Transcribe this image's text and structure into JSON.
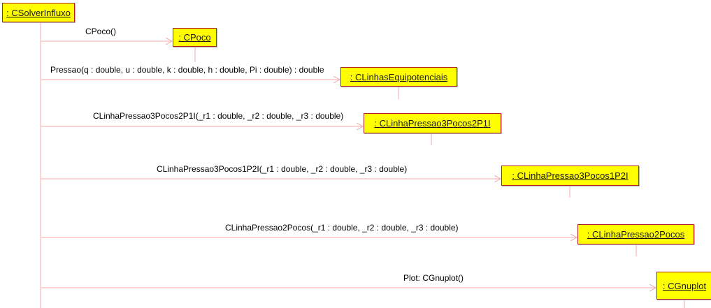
{
  "colors": {
    "object_fill": "#ffff00",
    "object_border": "#b22222",
    "lifeline": "#f4a9a9",
    "message_arrow": "#f4a9a9",
    "text": "#000000"
  },
  "objects": [
    {
      "id": "solver",
      "label": ": CSolverInfluxo"
    },
    {
      "id": "poco",
      "label": ": CPoco"
    },
    {
      "id": "linhas",
      "label": ": CLinhasEquipotenciais"
    },
    {
      "id": "p3p2p1i",
      "label": ": CLinhaPressao3Pocos2P1I"
    },
    {
      "id": "p3p1p2i",
      "label": ": CLinhaPressao3Pocos1P2I"
    },
    {
      "id": "p2pocos",
      "label": ": CLinhaPressao2Pocos"
    },
    {
      "id": "gnuplot",
      "label": ": CGnuplot"
    }
  ],
  "messages": [
    {
      "from": "solver",
      "to": "poco",
      "label": "CPoco()"
    },
    {
      "from": "solver",
      "to": "linhas",
      "label": "Pressao(q : double, u : double, k : double, h : double, Pi : double) : double"
    },
    {
      "from": "solver",
      "to": "p3p2p1i",
      "label": "CLinhaPressao3Pocos2P1I(_r1 : double, _r2 : double, _r3 : double)"
    },
    {
      "from": "solver",
      "to": "p3p1p2i",
      "label": "CLinhaPressao3Pocos1P2I(_r1 : double, _r2 : double, _r3 : double)"
    },
    {
      "from": "solver",
      "to": "p2pocos",
      "label": "CLinhaPressao2Pocos(_r1 : double, _r2 : double, _r3 : double)"
    },
    {
      "from": "solver",
      "to": "gnuplot",
      "label": "Plot: CGnuplot()"
    }
  ]
}
